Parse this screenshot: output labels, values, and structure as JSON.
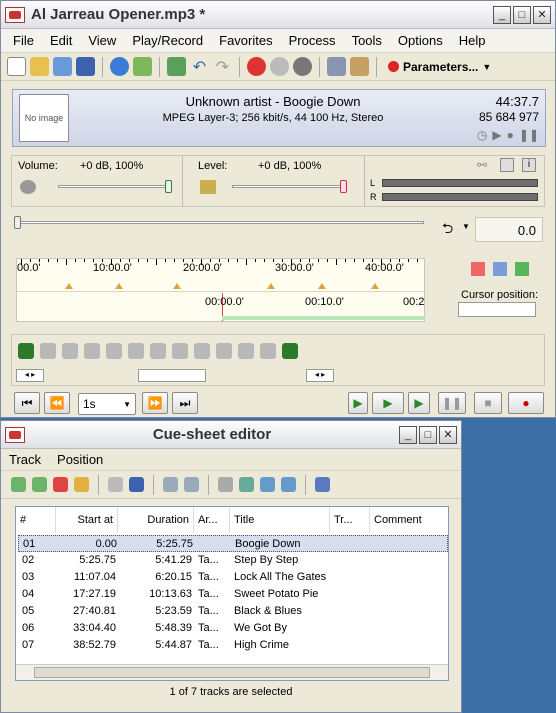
{
  "main_window": {
    "title": "Al Jarreau Opener.mp3 *",
    "menu": [
      "File",
      "Edit",
      "View",
      "Play/Record",
      "Favorites",
      "Process",
      "Tools",
      "Options",
      "Help"
    ],
    "params_label": "Parameters...",
    "info": {
      "no_image": "No image",
      "artist_title": "Unknown artist - Boogie Down",
      "format": "MPEG Layer-3; 256 kbit/s, 44 100 Hz, Stereo",
      "duration": "44:37.7",
      "size": "85 684 977"
    },
    "volume": {
      "label": "Volume:",
      "value": "+0 dB, 100%"
    },
    "level": {
      "label": "Level:",
      "value": "+0 dB, 100%"
    },
    "meter_l": "L",
    "meter_r": "R",
    "position_value": "0.0",
    "timeline": {
      "top_labels": [
        "00.0'",
        "10:00.0'",
        "20:00.0'",
        "30:00.0'",
        "40:00.0'"
      ],
      "bottom_labels": [
        "00:00.0'",
        "00:10.0'",
        "00:2"
      ]
    },
    "cursor_position_label": "Cursor position:",
    "step_value": "1s"
  },
  "cue_window": {
    "title": "Cue-sheet editor",
    "menu": [
      "Track",
      "Position"
    ],
    "columns": [
      "#",
      "Start at",
      "Duration",
      "Ar...",
      "Title",
      "Tr...",
      "Comment"
    ],
    "rows": [
      {
        "num": "01",
        "start": "0.00",
        "duration": "5:25.75",
        "artist": "",
        "title": "Boogie Down"
      },
      {
        "num": "02",
        "start": "5:25.75",
        "duration": "5:41.29",
        "artist": "Ta...",
        "title": "Step By Step"
      },
      {
        "num": "03",
        "start": "11:07.04",
        "duration": "6:20.15",
        "artist": "Ta...",
        "title": "Lock All The Gates"
      },
      {
        "num": "04",
        "start": "17:27.19",
        "duration": "10:13.63",
        "artist": "Ta...",
        "title": "Sweet Potato Pie"
      },
      {
        "num": "05",
        "start": "27:40.81",
        "duration": "5:23.59",
        "artist": "Ta...",
        "title": "Black & Blues"
      },
      {
        "num": "06",
        "start": "33:04.40",
        "duration": "5:48.39",
        "artist": "Ta...",
        "title": "We Got By"
      },
      {
        "num": "07",
        "start": "38:52.79",
        "duration": "5:44.87",
        "artist": "Ta...",
        "title": "High Crime"
      }
    ],
    "status": "1 of 7 tracks are selected"
  }
}
